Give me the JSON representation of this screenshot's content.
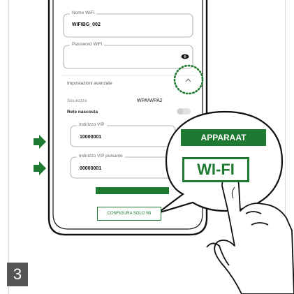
{
  "form": {
    "ssid_label": "Nome WiFi",
    "ssid_value": "WIFIBG_002",
    "password_label": "Password WiFi",
    "advanced_label": "Impostazioni avanzate",
    "security_label": "Sicurezza",
    "security_value": "WPA/WPA2",
    "hidden_network_label": "Rete nascosta",
    "vip_label": "Indirizzo VIP",
    "vip_value": "10000001",
    "vip_button_label": "Indirizzo VIP pulsante",
    "vip_button_value": "00000001",
    "configure_button": "CONFIGURA SOLO WI"
  },
  "callout": {
    "badge_top": "APPARAAT",
    "badge_bottom": "WI-FI"
  },
  "step_number": "3",
  "colors": {
    "accent": "#1f7a31",
    "step_bg": "#555555"
  },
  "icons": [
    "eye-icon",
    "chevron-up-icon",
    "arrow-right-icon",
    "toggle-switch",
    "hand-pointer-icon"
  ]
}
